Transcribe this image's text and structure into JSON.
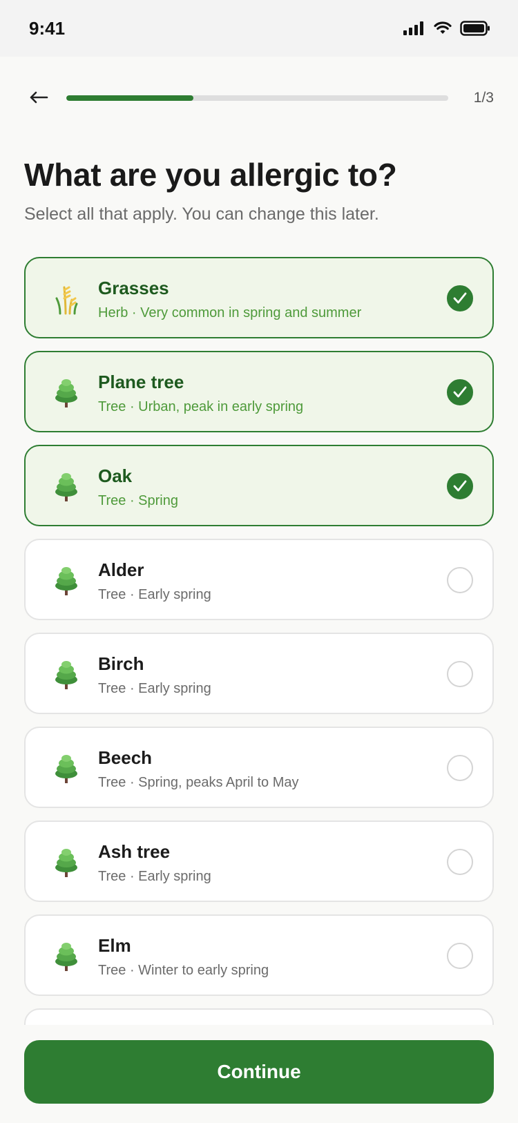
{
  "status_bar": {
    "time": "9:41"
  },
  "header": {
    "back_icon": "arrow-left-icon",
    "progress": 0.333,
    "step": "1/3"
  },
  "page": {
    "title": "What are you allergic to?",
    "subtitle": "Select all that apply. You can change this later."
  },
  "allergens": [
    {
      "name": "Grasses",
      "detail": "Herb · Very common in spring and summer",
      "icon": "grass-icon",
      "selected": true
    },
    {
      "name": "Plane tree",
      "detail": "Tree · Urban, peak in early spring",
      "icon": "tree-icon",
      "selected": true
    },
    {
      "name": "Oak",
      "detail": "Tree · Spring",
      "icon": "tree-icon",
      "selected": true
    },
    {
      "name": "Alder",
      "detail": "Tree · Early spring",
      "icon": "tree-icon",
      "selected": false
    },
    {
      "name": "Birch",
      "detail": "Tree · Early spring",
      "icon": "tree-icon",
      "selected": false
    },
    {
      "name": "Beech",
      "detail": "Tree · Spring, peaks April to May",
      "icon": "tree-icon",
      "selected": false
    },
    {
      "name": "Ash tree",
      "detail": "Tree · Early spring",
      "icon": "tree-icon",
      "selected": false
    },
    {
      "name": "Elm",
      "detail": "Tree · Winter to early spring",
      "icon": "tree-icon",
      "selected": false
    }
  ],
  "footer": {
    "continue_label": "Continue"
  },
  "colors": {
    "accent": "#2e7d32",
    "selected_bg": "#f0f6e9",
    "selected_sub": "#4e9a3a"
  }
}
